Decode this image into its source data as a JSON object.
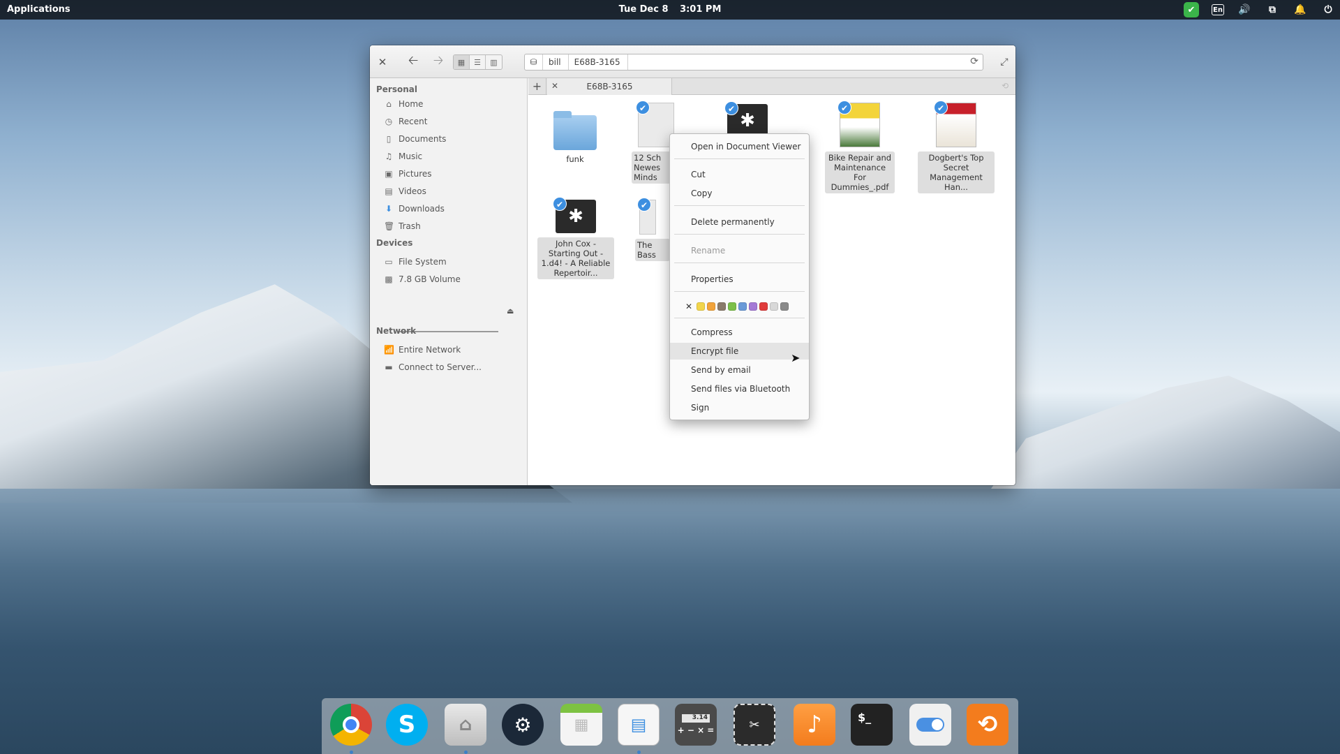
{
  "top_panel": {
    "applications_label": "Applications",
    "date": "Tue Dec  8",
    "time": "3:01 PM",
    "keyboard_layout": "En"
  },
  "window": {
    "path": [
      "bill",
      "E68B-3165"
    ],
    "tab_label": "E68B-3165"
  },
  "sidebar": {
    "personal_heading": "Personal",
    "personal_items": [
      {
        "label": "Home",
        "icon": "home-icon"
      },
      {
        "label": "Recent",
        "icon": "clock-icon"
      },
      {
        "label": "Documents",
        "icon": "document-icon"
      },
      {
        "label": "Music",
        "icon": "music-icon"
      },
      {
        "label": "Pictures",
        "icon": "picture-icon"
      },
      {
        "label": "Videos",
        "icon": "video-icon"
      },
      {
        "label": "Downloads",
        "icon": "download-icon"
      },
      {
        "label": "Trash",
        "icon": "trash-icon"
      }
    ],
    "devices_heading": "Devices",
    "device_items": [
      {
        "label": "File System",
        "icon": "drive-icon"
      },
      {
        "label": "7.8 GB Volume",
        "icon": "usb-drive-icon"
      }
    ],
    "network_heading": "Network",
    "network_items": [
      {
        "label": "Entire Network",
        "icon": "wifi-icon"
      },
      {
        "label": "Connect to Server...",
        "icon": "server-icon"
      }
    ]
  },
  "files": [
    {
      "name": "funk",
      "type": "folder",
      "selected": false
    },
    {
      "name": "12 Sch Newes Minds",
      "type": "document",
      "selected": true
    },
    {
      "name": "",
      "type": "executable",
      "selected": true
    },
    {
      "name": "Bike Repair and Maintenance For Dummies_.pdf",
      "type": "pdf",
      "selected": true
    },
    {
      "name": "Dogbert's Top Secret Management  Han...",
      "type": "pdf",
      "selected": true
    },
    {
      "name": "John Cox - Starting Out - 1.d4! - A Reliable Repertoir...",
      "type": "executable",
      "selected": true
    },
    {
      "name": "The Bass Handb",
      "type": "document",
      "selected": true
    }
  ],
  "context_menu": {
    "open_label": "Open in Document Viewer",
    "cut_label": "Cut",
    "copy_label": "Copy",
    "delete_label": "Delete permanently",
    "rename_label": "Rename",
    "properties_label": "Properties",
    "color_clear": "✕",
    "colors": [
      "#f2d54b",
      "#f2a33a",
      "#8a7b6b",
      "#7cc04a",
      "#6a9ad8",
      "#a57ad6",
      "#e03b3b",
      "#d8d8d8",
      "#8a8a8a"
    ],
    "compress_label": "Compress",
    "encrypt_label": "Encrypt file",
    "email_label": "Send by email",
    "bluetooth_label": "Send files via Bluetooth",
    "sign_label": "Sign"
  },
  "dock": {
    "items": [
      "chrome-icon",
      "skype-icon",
      "files-icon",
      "steam-icon",
      "calendar-icon",
      "image-viewer-icon",
      "calculator-icon",
      "screenshot-icon",
      "music-icon",
      "terminal-icon",
      "settings-switch-icon",
      "update-icon"
    ],
    "calculator_display": "3.14",
    "terminal_prompt": "$_"
  },
  "colors": {
    "accent": "#3d8fe0",
    "panel": "#000000"
  }
}
